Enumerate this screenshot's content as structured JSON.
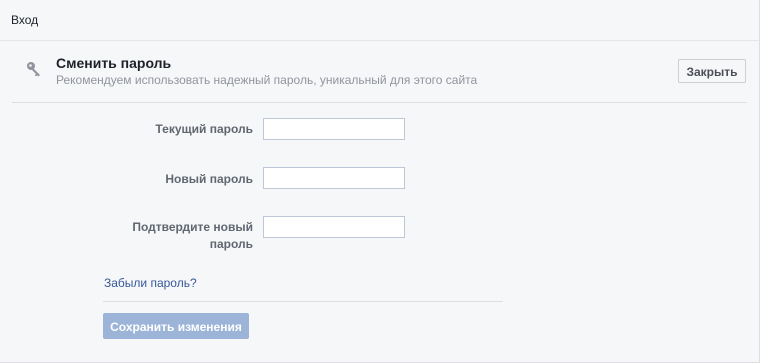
{
  "header": {
    "title": "Вход"
  },
  "section": {
    "icon": "key-icon",
    "title": "Сменить пароль",
    "description": "Рекомендуем использовать надежный пароль, уникальный для этого сайта",
    "close_label": "Закрыть"
  },
  "form": {
    "current_password": {
      "label": "Текущий пароль",
      "value": ""
    },
    "new_password": {
      "label": "Новый пароль",
      "value": ""
    },
    "confirm_password": {
      "label_line1": "Подтвердите новый",
      "label_line2": "пароль",
      "value": ""
    },
    "forgot_link": "Забыли пароль?",
    "save_label": "Сохранить изменения",
    "save_enabled": false
  },
  "colors": {
    "link": "#365899",
    "save_disabled_bg": "#9cb4d8",
    "panel_bg": "#f6f7f9",
    "label_text": "#606770"
  }
}
